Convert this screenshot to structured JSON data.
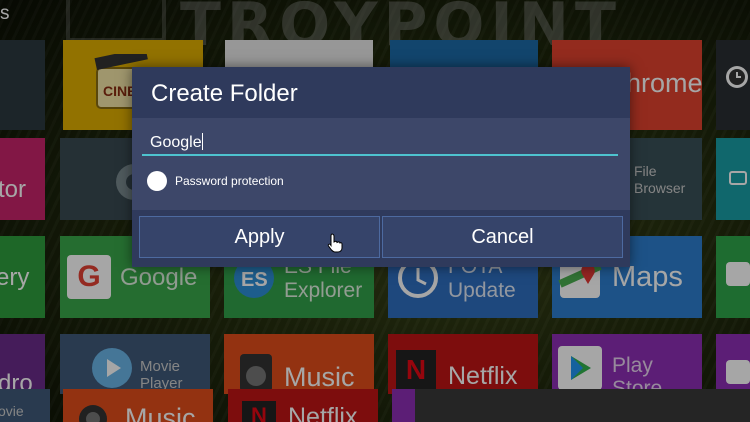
{
  "header": {
    "partial_title": "s",
    "brand": "TROYPOINT"
  },
  "tiles": {
    "cinema": {
      "label": "CINEMA"
    },
    "chrome": {
      "label": "hrome"
    },
    "editor": {
      "label": "tor"
    },
    "file_browser": {
      "label_line1": "File",
      "label_line2": "Browser"
    },
    "gallery": {
      "label": "ery"
    },
    "google": {
      "label": "Google"
    },
    "es_explorer": {
      "label_line1": "ES File",
      "label_line2": "Explorer"
    },
    "fota": {
      "label_line1": "FOTA",
      "label_line2": "Update"
    },
    "maps": {
      "label": "Maps"
    },
    "kodi": {
      "label": "dro"
    },
    "movie_player": {
      "label_line1": "Movie",
      "label_line2": "Player"
    },
    "music": {
      "label": "Music"
    },
    "netflix": {
      "label": "Netflix"
    },
    "play_store": {
      "label_line1": "Play",
      "label_line2": "Store"
    },
    "bottom_movie": {
      "label": "ovie"
    },
    "bottom_music": {
      "label": "Music"
    },
    "bottom_netflix": {
      "label": "Netflix"
    }
  },
  "dialog": {
    "title": "Create Folder",
    "folder_name_value": "Google",
    "password_label": "Password protection",
    "apply_label": "Apply",
    "cancel_label": "Cancel"
  },
  "colors": {
    "dialog_bg": "#2f3a5c",
    "input_underline": "#4ec3cf",
    "button_border": "#4d6aa0"
  }
}
